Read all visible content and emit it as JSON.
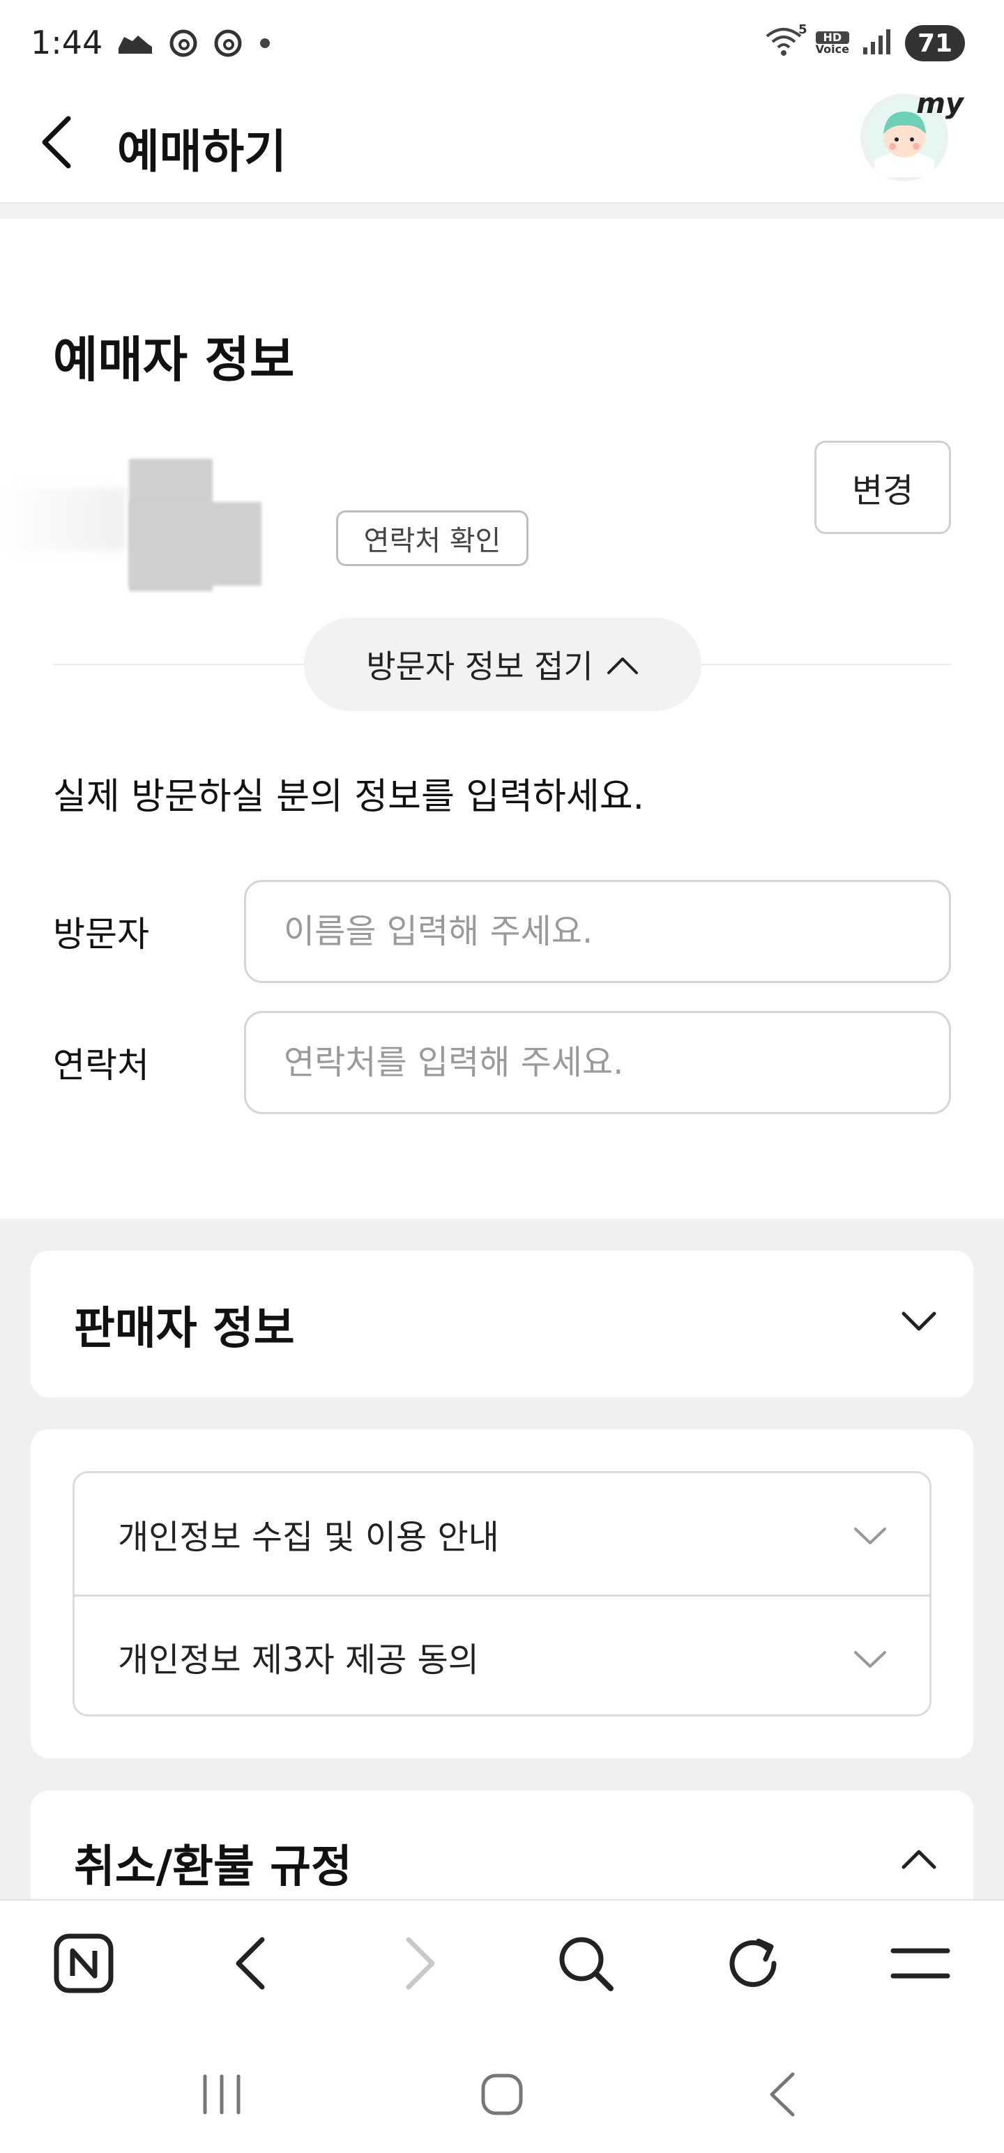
{
  "status_bar": {
    "time": "1:44",
    "left_icons": [
      "sneaker-icon",
      "threads-icon",
      "threads-icon",
      "dot-icon"
    ],
    "network": "5",
    "hd_voice_top": "HD",
    "hd_voice_bottom": "Voice",
    "battery": "71"
  },
  "header": {
    "title": "예매하기",
    "avatar_label": "my"
  },
  "booker": {
    "title": "예매자 정보",
    "change_label": "변경",
    "contact_verify_label": "연락처 확인",
    "visitor_toggle_label": "방문자 정보 접기"
  },
  "visitor": {
    "instruction": "실제 방문하실 분의 정보를 입력하세요.",
    "name_label": "방문자",
    "name_placeholder": "이름을 입력해 주세요.",
    "name_value": "",
    "phone_label": "연락처",
    "phone_placeholder": "연락처를 입력해 주세요.",
    "phone_value": ""
  },
  "seller": {
    "title": "판매자 정보"
  },
  "consents": [
    {
      "label": "개인정보 수집 및 이용 안내"
    },
    {
      "label": "개인정보 제3자 제공 동의"
    }
  ],
  "refund": {
    "title": "취소/환불 규정"
  },
  "browser_toolbar": [
    "naver-home-icon",
    "back-icon",
    "forward-icon",
    "search-icon",
    "refresh-icon",
    "menu-icon"
  ],
  "system_nav": [
    "recents-icon",
    "home-icon",
    "back-icon"
  ],
  "colors": {
    "background": "#ffffff",
    "gray_zone": "#f0f0f0",
    "border": "#d5d5d5",
    "placeholder": "#9a9a9a",
    "text": "#111111"
  }
}
